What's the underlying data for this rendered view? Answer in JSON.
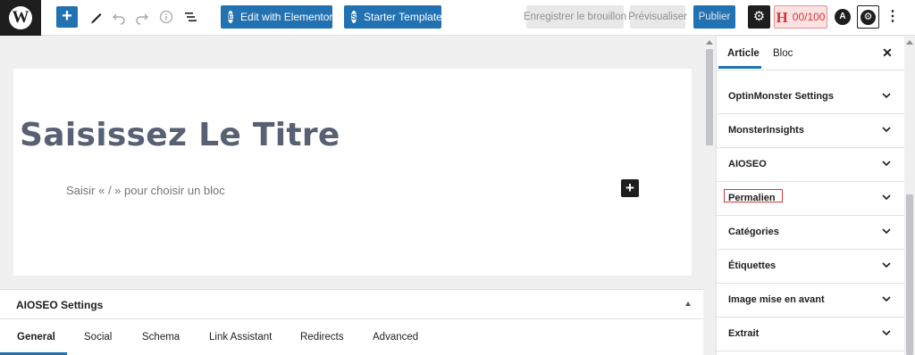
{
  "toolbar": {
    "logo_glyph": "W",
    "edit_elementor_label": "Edit with Elementor",
    "edit_elementor_glyph": "E",
    "starter_templates_label": "Starter Templates",
    "starter_templates_glyph": "S",
    "save_draft_label": "Enregistrer le brouillon",
    "preview_label": "Prévisualiser",
    "publish_label": "Publier",
    "seo_score": "00/100",
    "seo_score_glyph": "H",
    "astra_glyph": "A",
    "brand_color": "#2271b1",
    "score_color": "#d63638"
  },
  "editor": {
    "title_placeholder": "Saisissez Le Titre",
    "block_placeholder": "Saisir « / » pour choisir un bloc"
  },
  "metabox": {
    "title": "AIOSEO Settings",
    "tabs": [
      {
        "label": "General",
        "active": true
      },
      {
        "label": "Social"
      },
      {
        "label": "Schema"
      },
      {
        "label": "Link Assistant"
      },
      {
        "label": "Redirects"
      },
      {
        "label": "Advanced"
      }
    ]
  },
  "sidebar": {
    "tabs": [
      {
        "label": "Article",
        "active": true
      },
      {
        "label": "Bloc"
      }
    ],
    "panels": [
      {
        "label": "OptinMonster Settings"
      },
      {
        "label": "MonsterInsights"
      },
      {
        "label": "AIOSEO"
      },
      {
        "label": "Permalien",
        "highlighted": true
      },
      {
        "label": "Catégories"
      },
      {
        "label": "Étiquettes"
      },
      {
        "label": "Image mise en avant"
      },
      {
        "label": "Extrait"
      }
    ],
    "highlight_color": "#d63638"
  }
}
